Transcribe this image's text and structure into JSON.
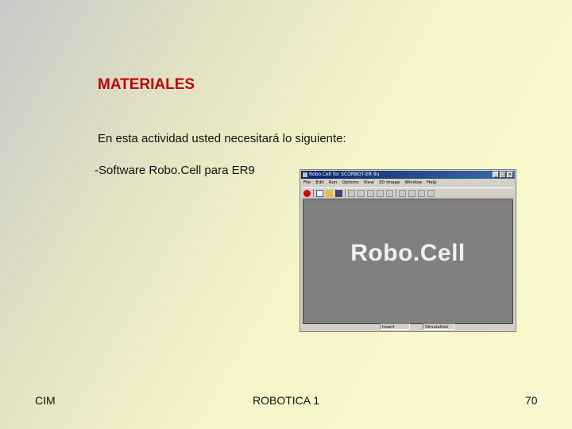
{
  "slide": {
    "title": "MATERIALES",
    "intro": "En esta actividad usted necesitará lo siguiente:",
    "item": "-Software Robo.Cell para ER9"
  },
  "footer": {
    "left": "CIM",
    "center": "ROBOTICA 1",
    "right": "70"
  },
  "app_window": {
    "title": "Robo.Cell for SCORBOT-ER 9u",
    "menu": [
      "File",
      "Edit",
      "Run",
      "Options",
      "View",
      "3D Image",
      "Window",
      "Help"
    ],
    "toolbar_icons": [
      "stop-icon",
      "new-file-icon",
      "open-file-icon",
      "save-icon",
      "teach-icon",
      "xyz-icon",
      "run-icon",
      "reset-icon",
      "home-icon",
      "cycle-icon",
      "axes-icon",
      "grip-icon",
      "pro-icon"
    ],
    "brand": "Robo.Cell",
    "status": {
      "mode": "Insert",
      "sim": "Simulation"
    }
  }
}
